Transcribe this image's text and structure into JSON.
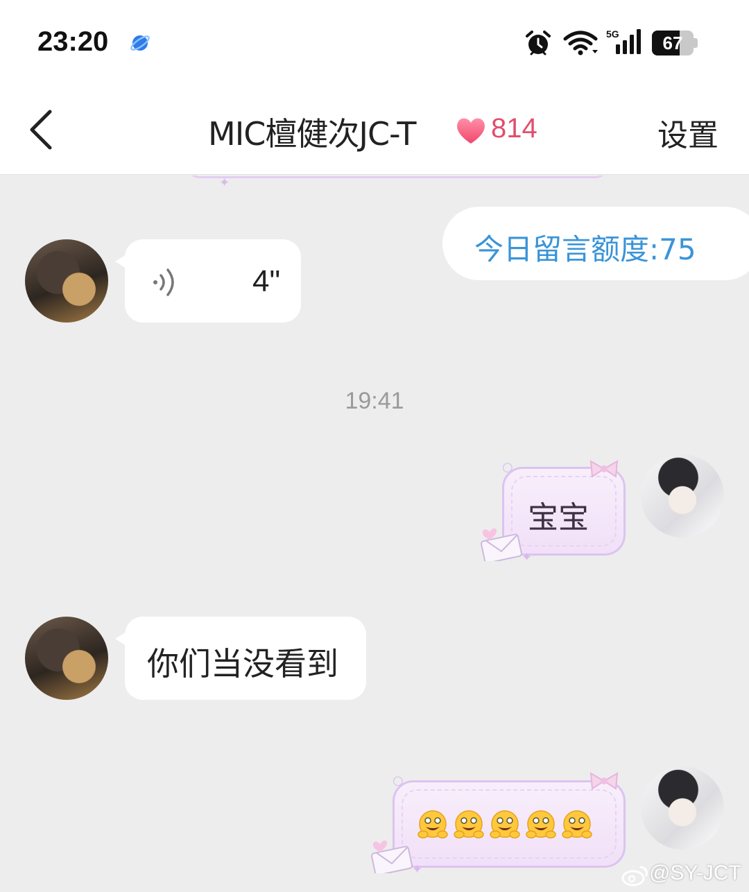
{
  "status_bar": {
    "time": "23:20",
    "network": "5G",
    "battery": "67",
    "battery_level_percent": 67
  },
  "nav": {
    "title": "MIC檀健次JC-T",
    "intimacy_count": "814",
    "settings_label": "设置"
  },
  "chat": {
    "quota_text": "今日留言额度:75",
    "messages": [
      {
        "sender": "other",
        "type": "voice",
        "duration": "4\""
      },
      {
        "sender": "self",
        "type": "text",
        "text": "宝宝"
      },
      {
        "sender": "other",
        "type": "text",
        "text": "你们当没看到"
      },
      {
        "sender": "self",
        "type": "emoji",
        "emoji_count": 5
      }
    ],
    "timestamp": "19:41"
  },
  "watermark": "@SY-JCT",
  "colors": {
    "background": "#ededed",
    "quota_blue": "#3a94d8",
    "heart_pink": "#e04f6d",
    "bubble_lavender": "#dcc3ef"
  }
}
